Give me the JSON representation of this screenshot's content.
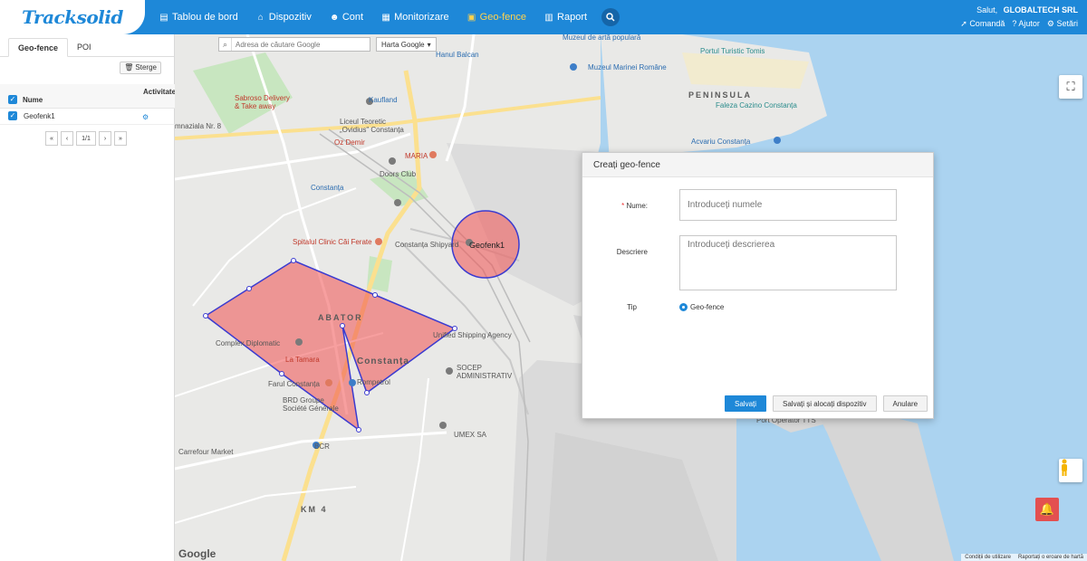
{
  "app": {
    "logo": "Tracksolid"
  },
  "nav": {
    "items": [
      {
        "label": "Tablou de bord",
        "icon": "dashboard-icon"
      },
      {
        "label": "Dispozitiv",
        "icon": "device-icon"
      },
      {
        "label": "Cont",
        "icon": "users-icon"
      },
      {
        "label": "Monitorizare",
        "icon": "map-icon"
      },
      {
        "label": "Geo-fence",
        "icon": "geofence-icon"
      },
      {
        "label": "Raport",
        "icon": "report-icon"
      }
    ],
    "active": "Geo-fence"
  },
  "user": {
    "greeting": "Salut,",
    "company": "GLOBALTECH SRL",
    "links": [
      "Comandă",
      "Ajutor",
      "Setări"
    ]
  },
  "sidebar": {
    "tabs": [
      "Geo-fence",
      "POI"
    ],
    "delete_label": "Sterge",
    "col_name": "Nume",
    "col_activity": "Activitate",
    "rows": [
      {
        "name": "Geofenk1"
      }
    ],
    "pager": {
      "first": "«",
      "prev": "‹",
      "page": "1/1",
      "next": "›",
      "last": "»"
    }
  },
  "map": {
    "search_placeholder": "Adresa de căutare Google",
    "map_type": "Harta Google",
    "fence_label": "Geofenk1",
    "labels": {
      "hanul": "Hanul Balcan",
      "muzeul_arta": "Muzeul de artă populară",
      "portul": "Portul Turistic Tomis",
      "muzeul_marinei": "Muzeul Marinei Române",
      "peninsula": "PENINSULA",
      "faleza": "Faleza Cazino Constanța",
      "sabroso": "Sabroso Delivery\n& Take away",
      "kaufland": "Kaufland",
      "liceul": "Liceul Teoretic\n„Ovidius\" Constanța",
      "oz": "Oz Demir",
      "maria": "MARIA",
      "doors": "Doors Club",
      "acvariu": "Acvariu Constanța",
      "constanta1": "Constanța",
      "spitalul": "Spitalul Clinic Căi Ferate",
      "shipyard": "Constanța Shipyard",
      "abator": "ABATOR",
      "complex": "Complex Diplomatic",
      "tamara": "La Tamara",
      "constanta2": "Constanța",
      "unified": "Unified Shipping Agency",
      "socep": "SOCEP\nADMINISTRATIV",
      "farul": "Farul Constanța",
      "rompetrol": "Rompetrol",
      "brd": "BRD Groupe\nSociété Générale",
      "carrefour": "Carrefour Market",
      "bcr": "BCR",
      "umex": "UMEX SA",
      "km4": "KM 4",
      "gimnaziala": "mnaziala Nr. 8",
      "port_op": "Port Operator TTS",
      "google": "Google"
    },
    "terms": [
      "Condiții de utilizare",
      "Raportați o eroare de hartă"
    ]
  },
  "dialog": {
    "title": "Creați geo-fence",
    "name_label": "Nume:",
    "name_required": "*",
    "name_placeholder": "Introduceți numele",
    "desc_label": "Descriere",
    "desc_placeholder": "Introduceți descrierea",
    "type_label": "Tip",
    "type_value": "Geo-fence",
    "btn_save": "Salvați",
    "btn_save_assign": "Salvați și alocați dispozitiv",
    "btn_cancel": "Anulare"
  }
}
